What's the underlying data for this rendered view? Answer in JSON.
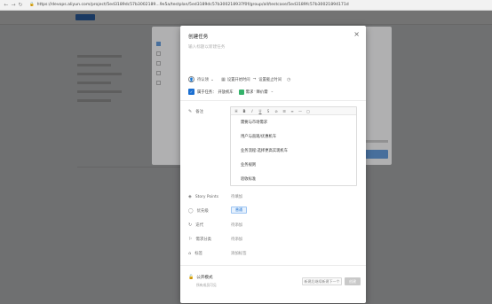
{
  "browser": {
    "url": "https://devops.aliyun.com/project/5ed3189dc57b3002189...9e5a/testplan/5ed3189dc57b300218937f0f/group/all/testcase/5ed3189fc57b30021894171d"
  },
  "background": {
    "title": "",
    "under_panel": {
      "items": [
        "",
        "",
        "",
        "",
        ""
      ],
      "footer": "",
      "button": ""
    }
  },
  "dialog": {
    "title": "创建任务",
    "title_placeholder": "输入标题以新建任务",
    "meta": {
      "assignee": "待认领",
      "start_time": "设置开始时间",
      "deadline": "设置截止时间"
    },
    "belong": {
      "label": "属于任务：",
      "project": "开放机车",
      "req_type": "需求",
      "req_name": "降价需"
    },
    "fields": {
      "remark_label": "备注",
      "story_points_label": "Story Points",
      "story_points_value": "待填加",
      "priority_label": "优先级",
      "priority_value": "普通",
      "iteration_label": "迭代",
      "iteration_value": "待添加",
      "req_category_label": "需求分类",
      "req_category_value": "待添加",
      "tag_label": "标签",
      "tag_value": "添加标签"
    },
    "editor": {
      "toolbar": [
        "H",
        "B",
        "I",
        "U",
        "S",
        "⊘",
        "☰",
        "≡",
        "—",
        "▢"
      ],
      "lines": [
        "需要与市场需求",
        "用户与直观/优惠机车",
        "业务流程:选择更高实现机车",
        "业务规则",
        "验收标准"
      ]
    },
    "footer": {
      "public_label": "公开模式",
      "public_sub": "所有成员可见",
      "continue_button": "新建后继续新建下一个",
      "create_button": "创建"
    }
  }
}
